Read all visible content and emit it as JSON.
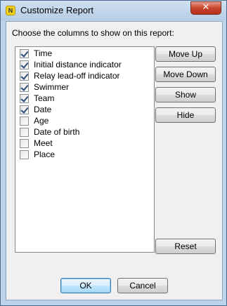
{
  "window": {
    "title": "Customize Report",
    "app_icon_letter": "N",
    "close_glyph": "✕"
  },
  "prompt": "Choose the columns to show on this report:",
  "columns": [
    {
      "label": "Time",
      "checked": true
    },
    {
      "label": "Initial distance indicator",
      "checked": true
    },
    {
      "label": "Relay lead-off indicator",
      "checked": true
    },
    {
      "label": "Swimmer",
      "checked": true
    },
    {
      "label": "Team",
      "checked": true
    },
    {
      "label": "Date",
      "checked": true
    },
    {
      "label": "Age",
      "checked": false
    },
    {
      "label": "Date of birth",
      "checked": false
    },
    {
      "label": "Meet",
      "checked": false
    },
    {
      "label": "Place",
      "checked": false
    }
  ],
  "buttons": {
    "move_up": "Move Up",
    "move_down": "Move Down",
    "show": "Show",
    "hide": "Hide",
    "reset": "Reset",
    "ok": "OK",
    "cancel": "Cancel"
  }
}
